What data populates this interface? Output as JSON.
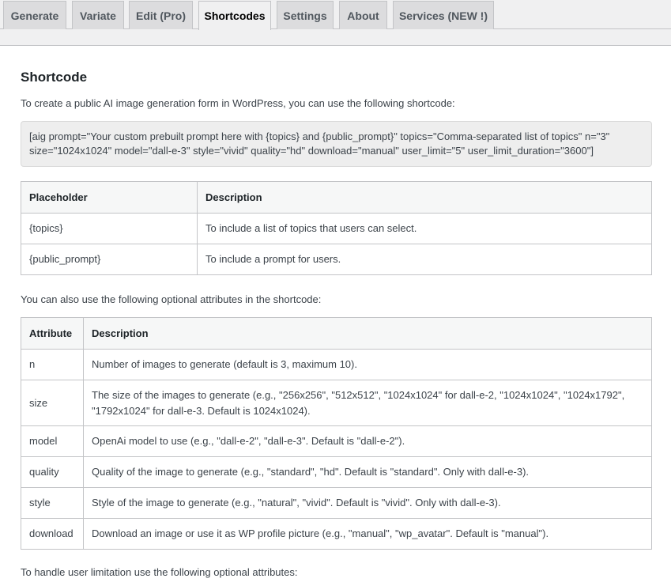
{
  "tabs": [
    {
      "label": "Generate"
    },
    {
      "label": "Variate"
    },
    {
      "label": "Edit (Pro)"
    },
    {
      "label": "Shortcodes"
    },
    {
      "label": "Settings"
    },
    {
      "label": "About"
    },
    {
      "label": "Services (NEW !)"
    }
  ],
  "section": {
    "title": "Shortcode",
    "intro": "To create a public AI image generation form in WordPress, you can use the following shortcode:",
    "shortcode_line1": "[aig prompt=\"Your custom prebuilt prompt here with {topics} and {public_prompt}\" topics=\"Comma-separated list of topics\" n=\"3\"",
    "shortcode_line2": "size=\"1024x1024\" model=\"dall-e-3\" style=\"vivid\" quality=\"hd\" download=\"manual\" user_limit=\"5\" user_limit_duration=\"3600\"]",
    "optional_intro": "You can also use the following optional attributes in the shortcode:",
    "limit_intro": "To handle user limitation use the following optional attributes:"
  },
  "placeholder_table": {
    "headers": [
      "Placeholder",
      "Description"
    ],
    "rows": [
      [
        "{topics}",
        "To include a list of topics that users can select."
      ],
      [
        "{public_prompt}",
        "To include a prompt for users."
      ]
    ]
  },
  "attribute_table": {
    "headers": [
      "Attribute",
      "Description"
    ],
    "rows": [
      [
        "n",
        "Number of images to generate (default is 3, maximum 10)."
      ],
      [
        "size",
        "The size of the images to generate (e.g., \"256x256\", \"512x512\", \"1024x1024\" for dall-e-2, \"1024x1024\", \"1024x1792\", \"1792x1024\" for dall-e-3. Default is 1024x1024)."
      ],
      [
        "model",
        "OpenAi model to use (e.g., \"dall-e-2\", \"dall-e-3\". Default is \"dall-e-2\")."
      ],
      [
        "quality",
        "Quality of the image to generate (e.g., \"standard\", \"hd\". Default is \"standard\". Only with dall-e-3)."
      ],
      [
        "style",
        "Style of the image to generate (e.g., \"natural\", \"vivid\". Default is \"vivid\". Only with dall-e-3)."
      ],
      [
        "download",
        "Download an image or use it as WP profile picture (e.g., \"manual\", \"wp_avatar\". Default is \"manual\")."
      ]
    ]
  }
}
